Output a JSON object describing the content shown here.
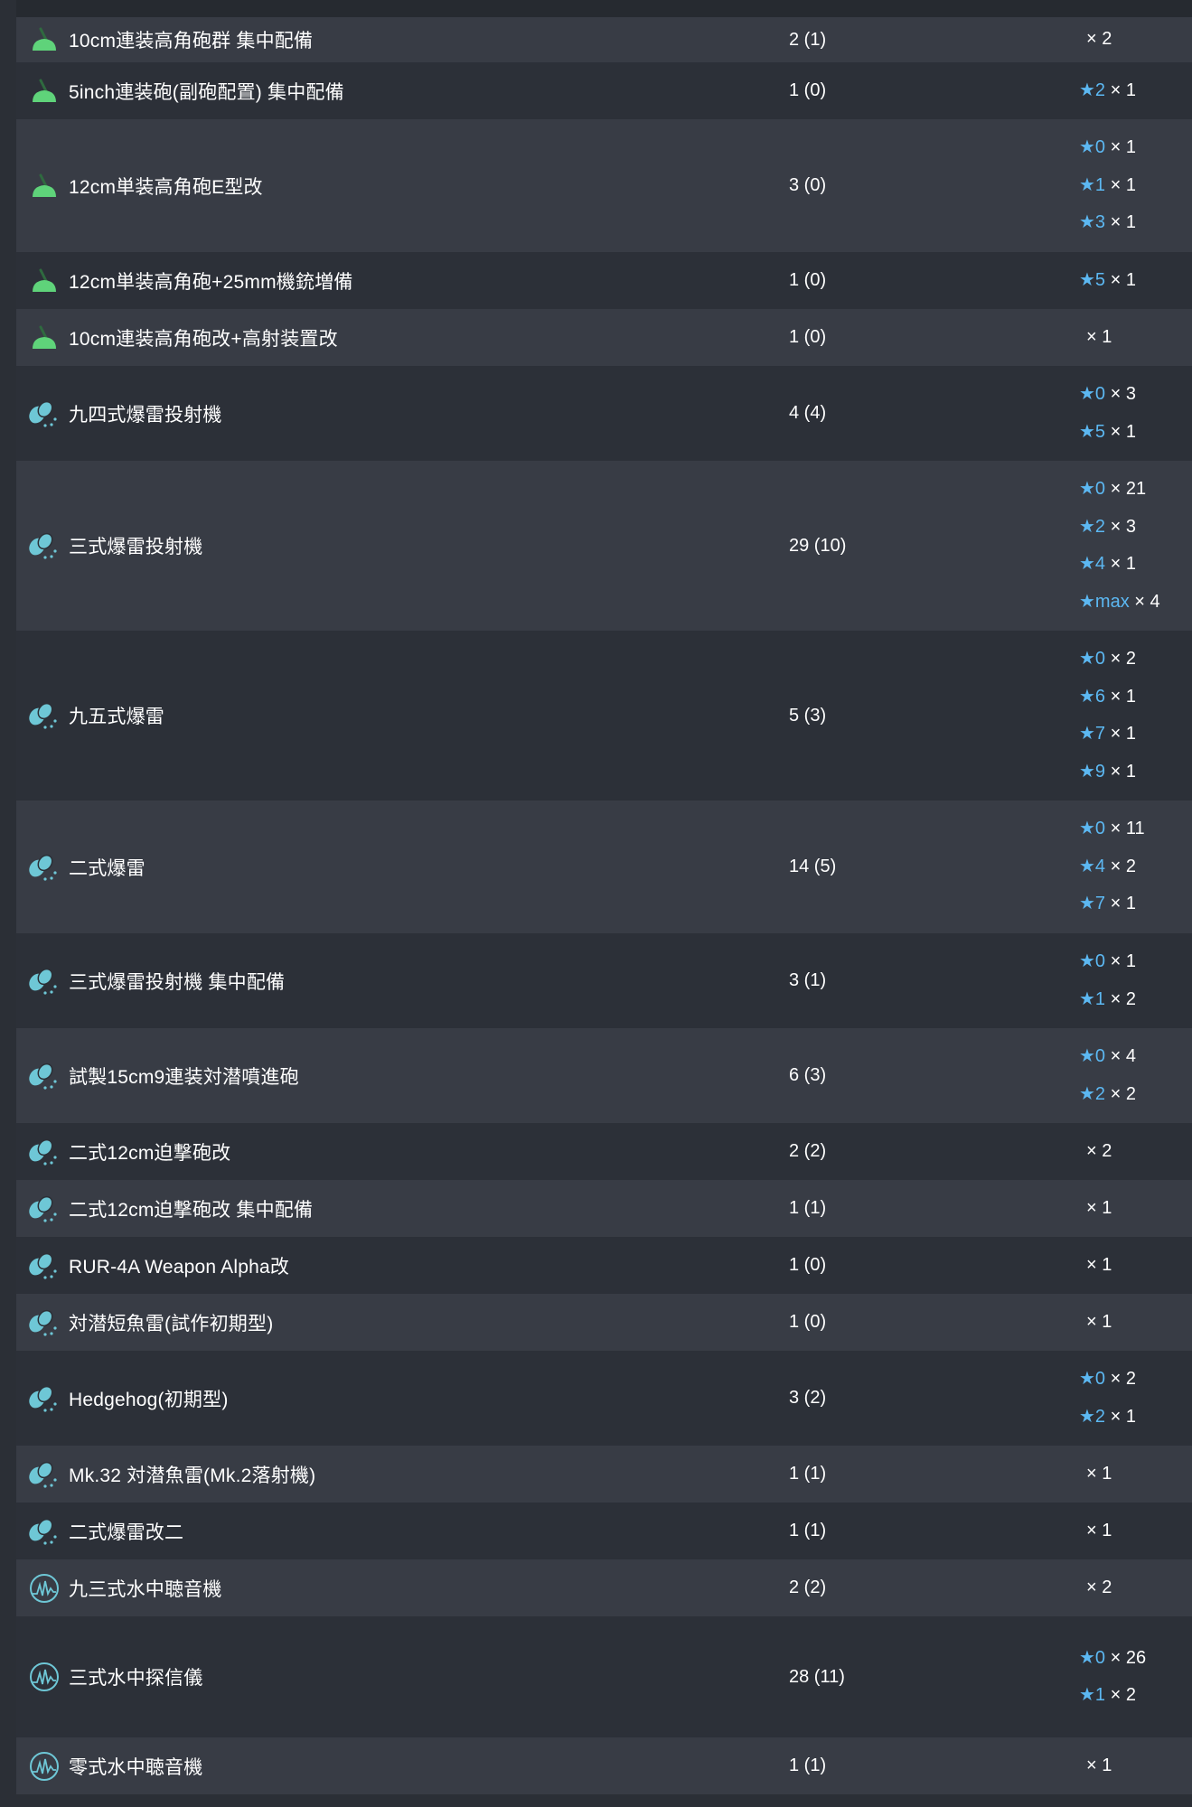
{
  "colors": {
    "background": "#2b2f36",
    "row_light": "#383c45",
    "row_dark": "#2c3038",
    "text": "#ffffff",
    "star": "#5cb8f2",
    "gun_icon": "#5fd37a",
    "asw_icon": "#6ec7d6"
  },
  "rows": [
    {
      "icon": "green-gun-icon",
      "name": "10cm連装高角砲群 集中配備",
      "count": "2 (1)",
      "improvements": [
        {
          "star": "",
          "times": "× 2"
        }
      ]
    },
    {
      "icon": "green-gun-icon",
      "name": "5inch連装砲(副砲配置) 集中配備",
      "count": "1 (0)",
      "improvements": [
        {
          "star": "★2",
          "times": " × 1"
        }
      ]
    },
    {
      "icon": "green-gun-icon",
      "name": "12cm単装高角砲E型改",
      "count": "3 (0)",
      "improvements": [
        {
          "star": "★0",
          "times": " × 1"
        },
        {
          "star": "★1",
          "times": " × 1"
        },
        {
          "star": "★3",
          "times": " × 1"
        }
      ]
    },
    {
      "icon": "green-gun-icon",
      "name": "12cm単装高角砲+25mm機銃増備",
      "count": "1 (0)",
      "improvements": [
        {
          "star": "★5",
          "times": " × 1"
        }
      ]
    },
    {
      "icon": "green-gun-icon",
      "name": "10cm連装高角砲改+高射装置改",
      "count": "1 (0)",
      "improvements": [
        {
          "star": "",
          "times": "× 1"
        }
      ]
    },
    {
      "icon": "depth-charge-icon",
      "name": "九四式爆雷投射機",
      "count": "4 (4)",
      "improvements": [
        {
          "star": "★0",
          "times": " × 3"
        },
        {
          "star": "★5",
          "times": " × 1"
        }
      ]
    },
    {
      "icon": "depth-charge-icon",
      "name": "三式爆雷投射機",
      "count": "29 (10)",
      "improvements": [
        {
          "star": "★0",
          "times": " × 21"
        },
        {
          "star": "★2",
          "times": " × 3"
        },
        {
          "star": "★4",
          "times": " × 1"
        },
        {
          "star": "★max",
          "times": " × 4"
        }
      ]
    },
    {
      "icon": "depth-charge-icon",
      "name": "九五式爆雷",
      "count": "5 (3)",
      "improvements": [
        {
          "star": "★0",
          "times": " × 2"
        },
        {
          "star": "★6",
          "times": " × 1"
        },
        {
          "star": "★7",
          "times": " × 1"
        },
        {
          "star": "★9",
          "times": " × 1"
        }
      ]
    },
    {
      "icon": "depth-charge-icon",
      "name": "二式爆雷",
      "count": "14 (5)",
      "improvements": [
        {
          "star": "★0",
          "times": " × 11"
        },
        {
          "star": "★4",
          "times": " × 2"
        },
        {
          "star": "★7",
          "times": " × 1"
        }
      ]
    },
    {
      "icon": "depth-charge-icon",
      "name": "三式爆雷投射機 集中配備",
      "count": "3 (1)",
      "improvements": [
        {
          "star": "★0",
          "times": " × 1"
        },
        {
          "star": "★1",
          "times": " × 2"
        }
      ]
    },
    {
      "icon": "depth-charge-icon",
      "name": "試製15cm9連装対潜噴進砲",
      "count": "6 (3)",
      "improvements": [
        {
          "star": "★0",
          "times": " × 4"
        },
        {
          "star": "★2",
          "times": " × 2"
        }
      ]
    },
    {
      "icon": "depth-charge-icon",
      "name": "二式12cm迫撃砲改",
      "count": "2 (2)",
      "improvements": [
        {
          "star": "",
          "times": "× 2"
        }
      ]
    },
    {
      "icon": "depth-charge-icon",
      "name": "二式12cm迫撃砲改 集中配備",
      "count": "1 (1)",
      "improvements": [
        {
          "star": "",
          "times": "× 1"
        }
      ]
    },
    {
      "icon": "depth-charge-icon",
      "name": "RUR-4A Weapon Alpha改",
      "count": "1 (0)",
      "improvements": [
        {
          "star": "",
          "times": "× 1"
        }
      ]
    },
    {
      "icon": "depth-charge-icon",
      "name": "対潜短魚雷(試作初期型)",
      "count": "1 (0)",
      "improvements": [
        {
          "star": "",
          "times": "× 1"
        }
      ]
    },
    {
      "icon": "depth-charge-icon",
      "name": "Hedgehog(初期型)",
      "count": "3 (2)",
      "improvements": [
        {
          "star": "★0",
          "times": " × 2"
        },
        {
          "star": "★2",
          "times": " × 1"
        }
      ]
    },
    {
      "icon": "depth-charge-icon",
      "name": "Mk.32 対潜魚雷(Mk.2落射機)",
      "count": "1 (1)",
      "improvements": [
        {
          "star": "",
          "times": "× 1"
        }
      ]
    },
    {
      "icon": "depth-charge-icon",
      "name": "二式爆雷改二",
      "count": "1 (1)",
      "improvements": [
        {
          "star": "",
          "times": "× 1"
        }
      ]
    },
    {
      "icon": "sonar-icon",
      "name": "九三式水中聴音機",
      "count": "2 (2)",
      "improvements": [
        {
          "star": "",
          "times": "× 2"
        }
      ]
    },
    {
      "icon": "sonar-icon",
      "name": "三式水中探信儀",
      "count": "28 (11)",
      "improvements": [
        {
          "star": "★0",
          "times": " × 26"
        },
        {
          "star": "★1",
          "times": " × 2"
        }
      ]
    },
    {
      "icon": "sonar-icon",
      "name": "零式水中聴音機",
      "count": "1 (1)",
      "improvements": [
        {
          "star": "",
          "times": "× 1"
        }
      ]
    }
  ]
}
